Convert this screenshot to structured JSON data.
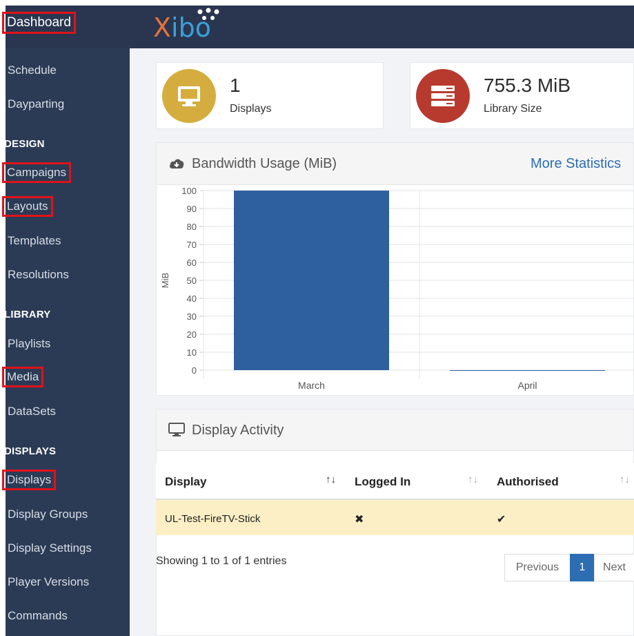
{
  "app": {
    "logo_x": "X",
    "logo_rest": "ibo"
  },
  "sidebar": {
    "dashboard": "Dashboard",
    "items_top": [
      "Schedule",
      "Dayparting"
    ],
    "sections": {
      "design": "DESIGN",
      "library": "LIBRARY",
      "displays": "DISPLAYS"
    },
    "design_items": [
      "Campaigns",
      "Layouts",
      "Templates",
      "Resolutions"
    ],
    "library_items": [
      "Playlists",
      "Media",
      "DataSets"
    ],
    "display_items": [
      "Displays",
      "Display Groups",
      "Display Settings",
      "Player Versions",
      "Commands"
    ]
  },
  "stats": {
    "displays": {
      "value": "1",
      "label": "Displays",
      "color": "#d4ad3e",
      "icon": "monitor-icon"
    },
    "library": {
      "value": "755.3 MiB",
      "label": "Library Size",
      "color": "#b83a2e",
      "icon": "server-icon"
    }
  },
  "bandwidth": {
    "title": "Bandwidth Usage (MiB)",
    "more_link": "More Statistics",
    "icon": "cloud-download-icon"
  },
  "chart_data": {
    "type": "bar",
    "categories": [
      "March",
      "April"
    ],
    "values": [
      100,
      0
    ],
    "ylabel": "MiB",
    "ylim": [
      0,
      100
    ],
    "yticks": [
      0,
      10,
      20,
      30,
      40,
      50,
      60,
      70,
      80,
      90,
      100
    ],
    "bar_color": "#2e5f9e",
    "grid": true
  },
  "activity": {
    "title": "Display Activity",
    "icon": "monitor-icon",
    "columns": [
      "Display",
      "Logged In",
      "Authorised"
    ],
    "rows": [
      {
        "display": "UL-Test-FireTV-Stick",
        "logged_in": "✖",
        "authorised": "✔"
      }
    ],
    "showing": "Showing 1 to 1 of 1 entries",
    "pager": {
      "previous": "Previous",
      "page": "1",
      "next": "Next"
    }
  }
}
